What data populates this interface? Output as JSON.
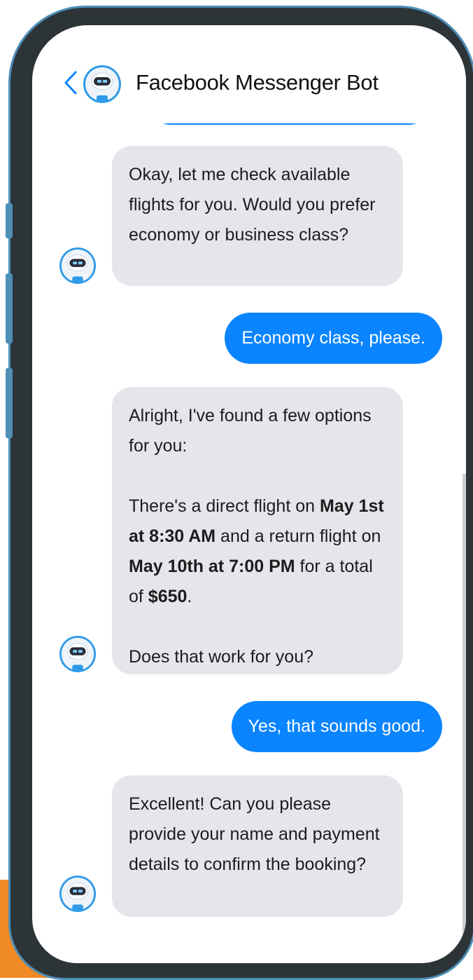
{
  "header": {
    "back_icon": "chevron-left-icon",
    "avatar_icon": "robot-avatar-icon",
    "title": "Facebook Messenger Bot"
  },
  "colors": {
    "user_bubble": "#0a84ff",
    "bot_bubble": "#e4e6eb",
    "frame": "#2d3438",
    "frame_accent": "#4f8fb8",
    "background_accent": "#f08a24"
  },
  "messages": [
    {
      "sender": "bot",
      "text": "Okay, let me check available flights for you. Would you prefer economy or business class?"
    },
    {
      "sender": "user",
      "text": "Economy class, please."
    },
    {
      "sender": "bot",
      "intro": "Alright, I've found a few options for you:",
      "p2_a": "There's a direct flight on ",
      "p2_depart": "May 1st at 8:30 AM",
      "p2_b": " and a return flight on ",
      "p2_return": "May 10th at 7:00 PM",
      "p2_c": " for a total of ",
      "p2_price": "$650",
      "p2_d": ".",
      "question": "Does that work for you?"
    },
    {
      "sender": "user",
      "text": "Yes, that sounds good."
    },
    {
      "sender": "bot",
      "text": "Excellent! Can you please provide your name and payment details to confirm the booking?"
    }
  ]
}
